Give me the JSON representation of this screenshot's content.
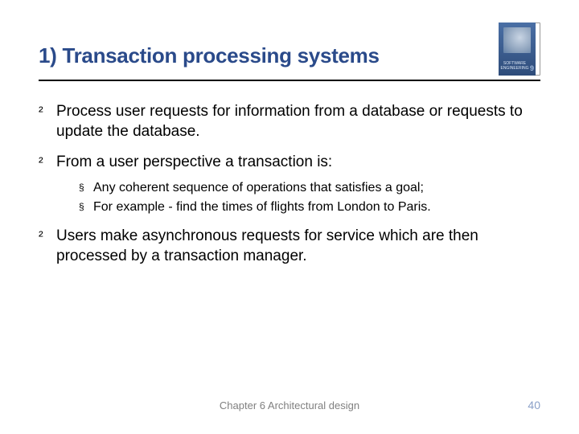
{
  "title": "1) Transaction processing systems",
  "book": {
    "label": "SOFTWARE ENGINEERING",
    "edition": "9"
  },
  "bullets": {
    "b1": "Process user requests for information from a database or requests to update the database.",
    "b2": "From a user perspective a transaction is:",
    "b2_sub1": "Any coherent sequence of operations that satisfies a goal;",
    "b2_sub2": "For example - find the times of flights from London to Paris.",
    "b3": "Users make asynchronous requests for service which are then processed by a transaction manager."
  },
  "footer": {
    "center": "Chapter 6 Architectural design",
    "page": "40"
  }
}
